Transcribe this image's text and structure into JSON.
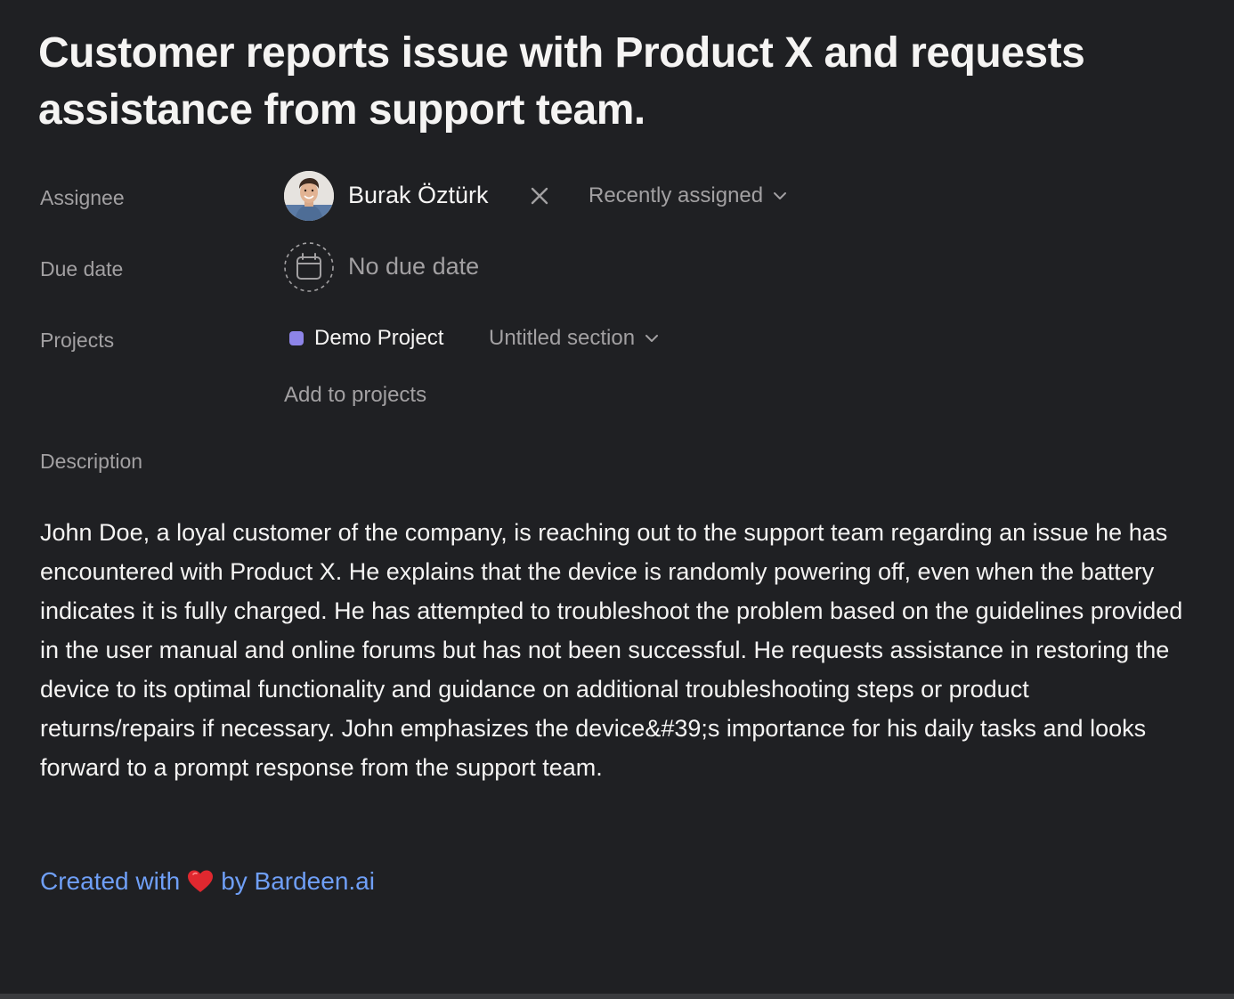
{
  "task": {
    "title": "Customer reports issue with Product X and requests assistance from support team."
  },
  "fields": {
    "assignee_label": "Assignee",
    "due_date_label": "Due date",
    "projects_label": "Projects",
    "description_label": "Description"
  },
  "assignee": {
    "name": "Burak Öztürk",
    "recent_label": "Recently assigned",
    "remove_icon": "close-icon",
    "dropdown_icon": "chevron-down-icon"
  },
  "due_date": {
    "value": "No due date",
    "icon": "calendar-icon"
  },
  "projects": {
    "items": [
      {
        "name": "Demo Project",
        "color": "#8d84e8",
        "section": "Untitled section"
      }
    ],
    "add_label": "Add to projects"
  },
  "description": {
    "text": "John Doe, a loyal customer of the company, is reaching out to the support team regarding an issue he has encountered with Product X. He explains that the device is randomly powering off, even when the battery indicates it is fully charged. He has attempted to troubleshoot the problem based on the guidelines provided in the user manual and online forums but has not been successful. He requests assistance in restoring the device to its optimal functionality and guidance on additional troubleshooting steps or product returns/repairs if necessary. John emphasizes the device&#39;s importance for his daily tasks and looks forward to a prompt response from the support team."
  },
  "footer": {
    "created_with": "Created with",
    "by_text": "by Bardeen.ai",
    "link_color": "#6f9ff7",
    "heart_icon": "heart-icon"
  },
  "colors": {
    "background": "#1f2023",
    "text_primary": "#f5f4f3",
    "text_secondary": "#a2a0a2"
  }
}
